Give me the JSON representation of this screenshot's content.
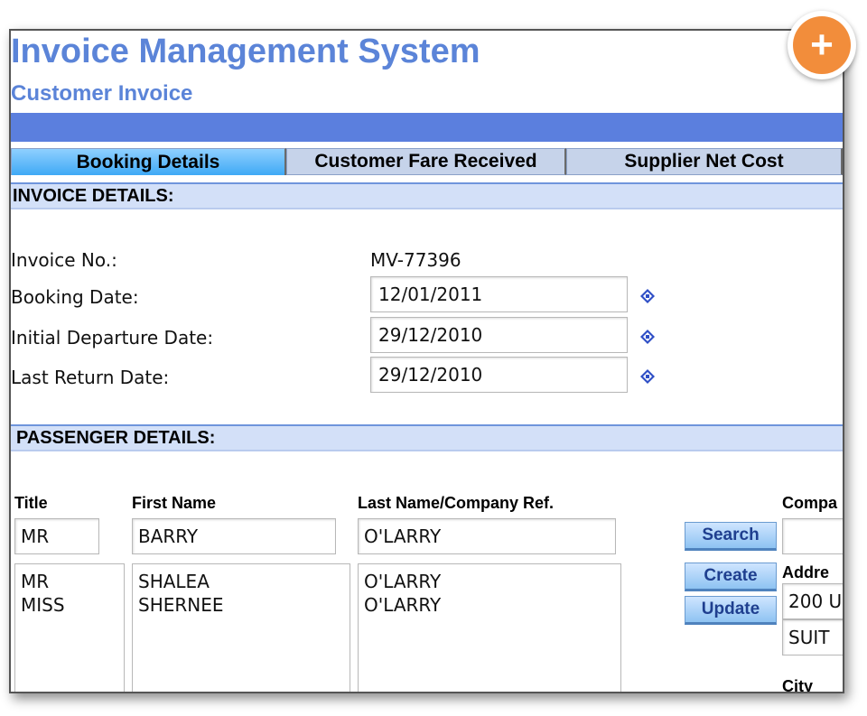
{
  "header": {
    "title": "Invoice Management System",
    "subtitle": "Customer Invoice"
  },
  "tabs": [
    {
      "label": "Booking Details",
      "active": true
    },
    {
      "label": "Customer Fare Received",
      "active": false
    },
    {
      "label": "Supplier Net Cost",
      "active": false
    }
  ],
  "invoice_details": {
    "heading": "INVOICE DETAILS:",
    "invoice_no_label": "Invoice No.:",
    "invoice_no_value": "MV-77396",
    "booking_date_label": "Booking Date:",
    "booking_date_value": "12/01/2011",
    "initial_departure_label": "Initial Departure Date:",
    "initial_departure_value": "29/12/2010",
    "last_return_label": "Last Return Date:",
    "last_return_value": "29/12/2010"
  },
  "passenger_details": {
    "heading": "PASSENGER DETAILS:",
    "title_header": "Title",
    "first_name_header": "First Name",
    "last_name_header": "Last Name/Company Ref.",
    "company_header": "Compa",
    "address_label": "Addre",
    "city_label": "City",
    "title_input": "MR",
    "first_name_input": "BARRY",
    "last_name_input": "O'LARRY",
    "address_line1": "200 U",
    "address_line2": "SUIT",
    "list": {
      "titles": [
        "MR",
        "MISS"
      ],
      "first_names": [
        "SHALEA",
        "SHERNEE"
      ],
      "last_names": [
        "O'LARRY",
        "O'LARRY"
      ]
    },
    "buttons": {
      "search": "Search",
      "create": "Create",
      "update": "Update"
    }
  },
  "fab": {
    "icon": "plus-icon",
    "label": "+",
    "color": "#f28d3b"
  },
  "colors": {
    "accent": "#5b84d8",
    "bar": "#5b7fde",
    "section_bg": "#d3e0f8",
    "button_text": "#1f3f8f"
  }
}
